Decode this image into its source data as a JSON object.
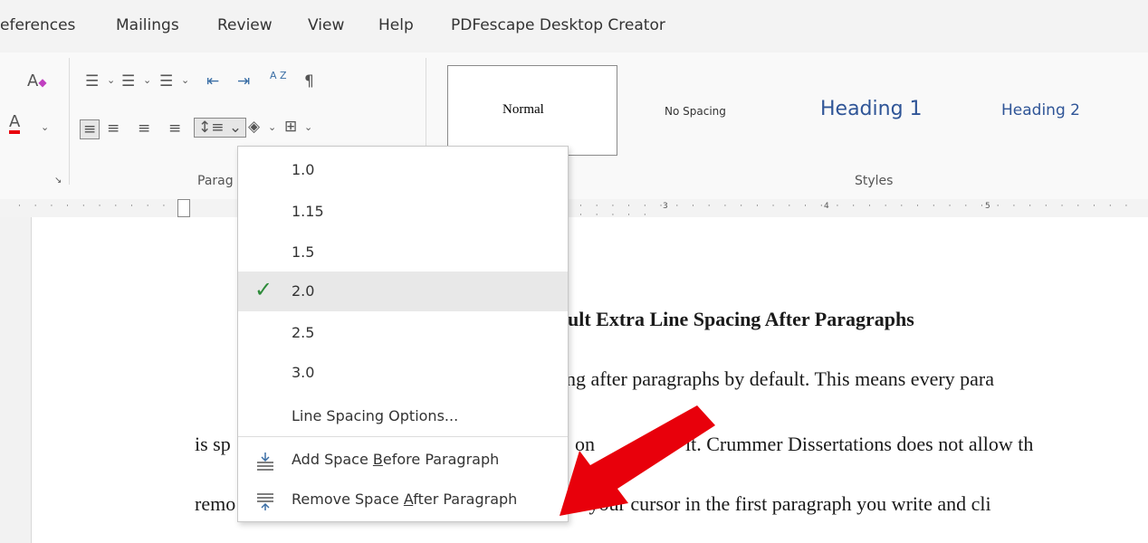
{
  "tabs": [
    "eferences",
    "Mailings",
    "Review",
    "View",
    "Help",
    "PDFescape Desktop Creator"
  ],
  "ribbon": {
    "paragraph_group_label": "Parag",
    "styles_group_label": "Styles",
    "styles": [
      {
        "label": "Normal",
        "color": "#000000"
      },
      {
        "label": "No Spacing",
        "color": "#333333"
      },
      {
        "label": "Heading 1",
        "color": "#2f5597"
      },
      {
        "label": "Heading 2",
        "color": "#2f5597"
      }
    ],
    "pilcrow": "¶",
    "sort_label": "A Z"
  },
  "ruler": {
    "marks": [
      "3",
      "4",
      "5"
    ]
  },
  "line_spacing_menu": {
    "options": [
      "1.0",
      "1.15",
      "1.5",
      "2.0",
      "2.5",
      "3.0"
    ],
    "selected": "2.0",
    "line_spacing_options": "Line Spacing Options...",
    "add_space_before": {
      "pre": "Add Space ",
      "ul": "B",
      "post": "efore Paragraph"
    },
    "remove_space_after": {
      "pre": "Remove Space ",
      "ul": "A",
      "post": "fter Paragraph"
    }
  },
  "document": {
    "heading_fragment": "ult Extra Line Spacing After Paragraphs",
    "line1_fragment": "ng after paragraphs by default.  This means every para",
    "line2_left": "is sp",
    "line2_mid": "on",
    "line2_right": "it.  Crummer Dissertations does not allow th",
    "line3_left": "remo",
    "line3_right": "on your cursor in the first paragraph you write and cli"
  },
  "colors": {
    "accent_red": "#e8000b",
    "check_green": "#2e8b3a",
    "heading_blue": "#2f5597"
  }
}
